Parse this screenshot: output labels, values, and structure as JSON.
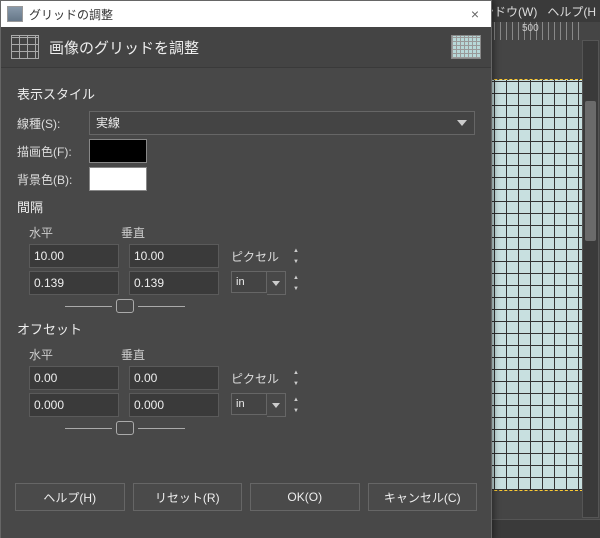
{
  "menubar": {
    "window": "ウィンドウ(W)",
    "help": "ヘルプ(H"
  },
  "ruler": {
    "mark": "500"
  },
  "dialog": {
    "title": "グリッドの調整",
    "close": "×",
    "heading": "画像のグリッドを調整",
    "style": {
      "section": "表示スタイル",
      "line_label": "線種(S):",
      "line_value": "実線",
      "fg_label": "描画色(F):",
      "bg_label": "背景色(B):"
    },
    "spacing": {
      "section": "間隔",
      "h": "水平",
      "v": "垂直",
      "hpx": "10.00",
      "vpx": "10.00",
      "hin": "0.139",
      "vin": "0.139",
      "unit_px": "ピクセル",
      "unit_in": "in"
    },
    "offset": {
      "section": "オフセット",
      "h": "水平",
      "v": "垂直",
      "hpx": "0.00",
      "vpx": "0.00",
      "hin": "0.000",
      "vin": "0.000",
      "unit_px": "ピクセル",
      "unit_in": "in"
    },
    "actions": {
      "help": "ヘルプ(H)",
      "reset": "リセット(R)",
      "ok": "OK(O)",
      "cancel": "キャンセル(C)"
    }
  }
}
